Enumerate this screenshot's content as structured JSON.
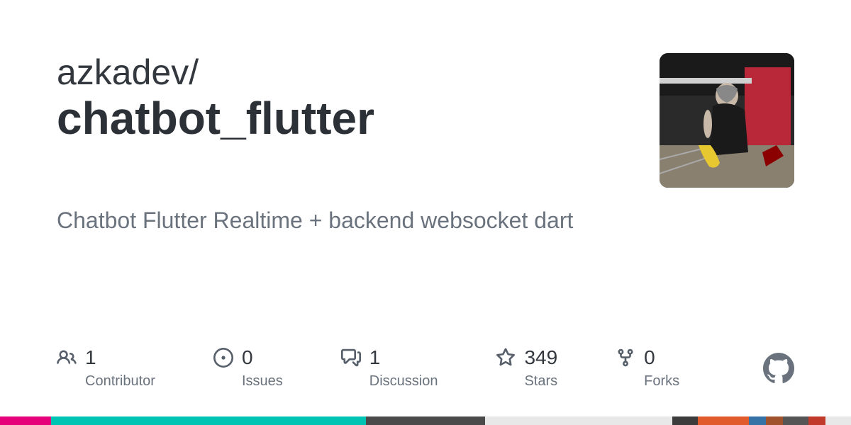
{
  "owner": "azkadev/",
  "repo": "chatbot_flutter",
  "description": "Chatbot Flutter Realtime + backend websocket dart",
  "stats": {
    "contributors": {
      "value": "1",
      "label": "Contributor"
    },
    "issues": {
      "value": "0",
      "label": "Issues"
    },
    "discussions": {
      "value": "1",
      "label": "Discussion"
    },
    "stars": {
      "value": "349",
      "label": "Stars"
    },
    "forks": {
      "value": "0",
      "label": "Forks"
    }
  },
  "colorBar": [
    {
      "color": "#e6007a",
      "width": "6%"
    },
    {
      "color": "#00c4b3",
      "width": "37%"
    },
    {
      "color": "#4a4a4a",
      "width": "14%"
    },
    {
      "color": "#e8e8e8",
      "width": "22%"
    },
    {
      "color": "#3c3c3c",
      "width": "3%"
    },
    {
      "color": "#e05a2b",
      "width": "6%"
    },
    {
      "color": "#3572A5",
      "width": "2%"
    },
    {
      "color": "#a0522d",
      "width": "2%"
    },
    {
      "color": "#555555",
      "width": "3%"
    },
    {
      "color": "#c0392b",
      "width": "2%"
    },
    {
      "color": "#e8e8e8",
      "width": "3%"
    }
  ]
}
